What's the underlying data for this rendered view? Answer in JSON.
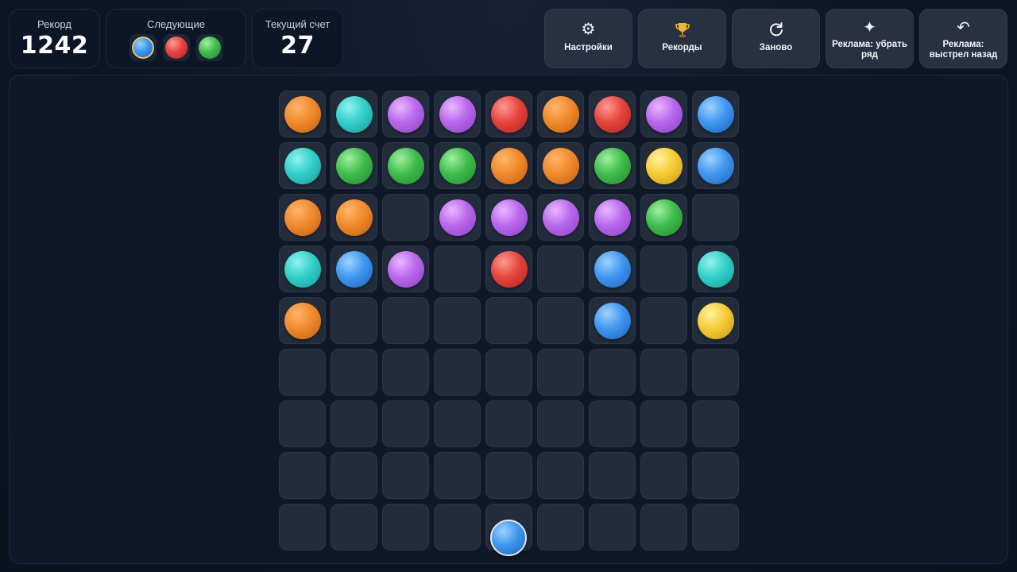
{
  "colors": {
    "orange": [
      "#ffb56b",
      "#f08a2c",
      "#c25f10"
    ],
    "cyan": [
      "#8ff3ef",
      "#32cfc9",
      "#149e99"
    ],
    "purple": [
      "#e7b8ff",
      "#b968ec",
      "#8a3fc4"
    ],
    "red": [
      "#ff9a93",
      "#e6443d",
      "#b3221d"
    ],
    "blue": [
      "#9fd2ff",
      "#3f97f0",
      "#1b63bf"
    ],
    "green": [
      "#9ef0a0",
      "#3fbc4c",
      "#218a2c"
    ],
    "yellow": [
      "#fff3a0",
      "#f4cc35",
      "#c9980d"
    ]
  },
  "stats": {
    "record": {
      "label": "Рекорд",
      "value": "1242"
    },
    "next": {
      "label": "Следующие",
      "balls": [
        "blue",
        "red",
        "green"
      ]
    },
    "score": {
      "label": "Текущий счет",
      "value": "27"
    }
  },
  "actions": {
    "settings": {
      "label": "Настройки",
      "icon": "gear-icon"
    },
    "records": {
      "label": "Рекорды",
      "icon": "trophy-icon"
    },
    "restart": {
      "label": "Заново",
      "icon": "refresh-icon"
    },
    "ad_remove_row": {
      "label": "Реклама: убрать ряд",
      "icon": "sparkle-icon"
    },
    "ad_undo_shot": {
      "label": "Реклама: выстрел назад",
      "icon": "undo-icon"
    }
  },
  "board": {
    "rows": [
      [
        "orange",
        "cyan",
        "purple",
        "purple",
        "red",
        "orange",
        "red",
        "purple",
        "blue"
      ],
      [
        "cyan",
        "green",
        "green",
        "green",
        "orange",
        "orange",
        "green",
        "yellow",
        "blue"
      ],
      [
        "orange",
        "orange",
        null,
        "purple",
        "purple",
        "purple",
        "purple",
        "green",
        null
      ],
      [
        "cyan",
        "blue",
        "purple",
        null,
        "red",
        null,
        "blue",
        null,
        "cyan"
      ],
      [
        "orange",
        null,
        null,
        null,
        null,
        null,
        "blue",
        null,
        "yellow"
      ],
      [
        null,
        null,
        null,
        null,
        null,
        null,
        null,
        null,
        null
      ],
      [
        null,
        null,
        null,
        null,
        null,
        null,
        null,
        null,
        null
      ],
      [
        null,
        null,
        null,
        null,
        null,
        null,
        null,
        null,
        null
      ],
      [
        null,
        null,
        null,
        null,
        null,
        null,
        null,
        null,
        null
      ]
    ],
    "shooter_color": "blue",
    "shooter_column": 5
  }
}
